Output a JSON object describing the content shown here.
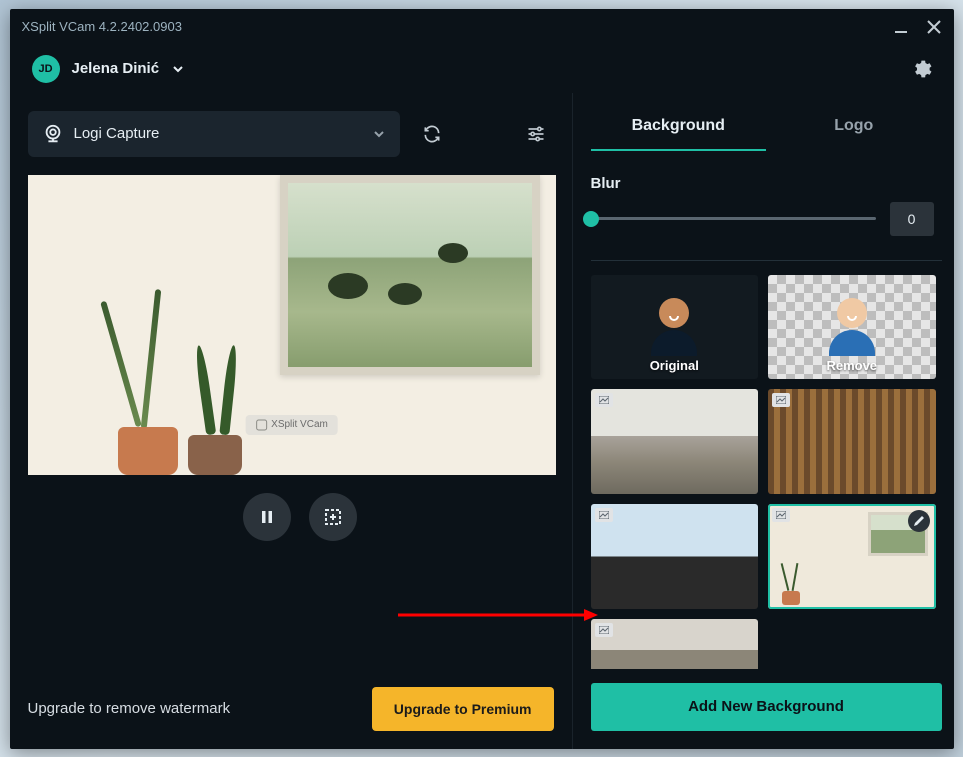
{
  "window": {
    "title": "XSplit VCam 4.2.2402.0903"
  },
  "user": {
    "initials": "JD",
    "name": "Jelena Dinić"
  },
  "camera": {
    "selected": "Logi Capture"
  },
  "watermark": {
    "text": "XSplit VCam"
  },
  "upgrade": {
    "text": "Upgrade to remove watermark",
    "button": "Upgrade to Premium"
  },
  "tabs": {
    "background": "Background",
    "logo": "Logo"
  },
  "blur": {
    "label": "Blur",
    "value": "0"
  },
  "bg_items": {
    "original": "Original",
    "remove": "Remove"
  },
  "add_bg": {
    "label": "Add New Background"
  }
}
